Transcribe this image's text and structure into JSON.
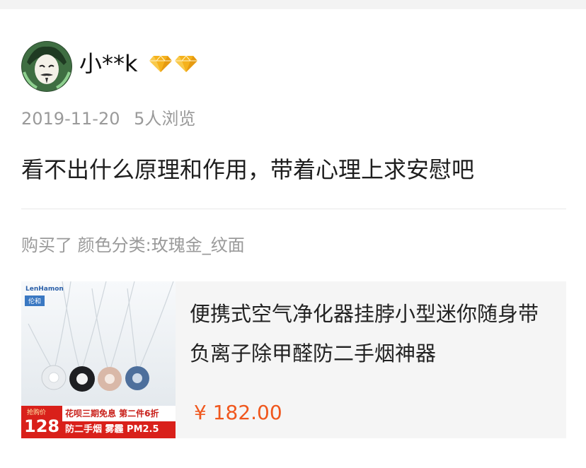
{
  "user": {
    "name": "小**k",
    "badges": [
      "diamond-icon",
      "diamond-icon"
    ]
  },
  "meta": {
    "date": "2019-11-20",
    "views": "5人浏览"
  },
  "review": {
    "text": "看不出什么原理和作用，带着心理上求安慰吧"
  },
  "purchase": {
    "info": "购买了 颜色分类:玫瑰金_纹面"
  },
  "product": {
    "title": "便携式空气净化器挂脖小型迷你随身带负离子除甲醛防二手烟神器",
    "price": "¥ 182.00",
    "image": {
      "brand": "LenHamon",
      "tag": "伦和",
      "promo_label": "抢购价",
      "promo_price": "128",
      "promo_line1": "花呗三期免息 第二件6折",
      "promo_line2": "防二手烟 雾霾 PM2.5"
    }
  },
  "colors": {
    "price": "#f0571d",
    "meta": "#9a9a9a",
    "promo_red": "#d9201a",
    "card_bg": "#f5f5f5"
  }
}
